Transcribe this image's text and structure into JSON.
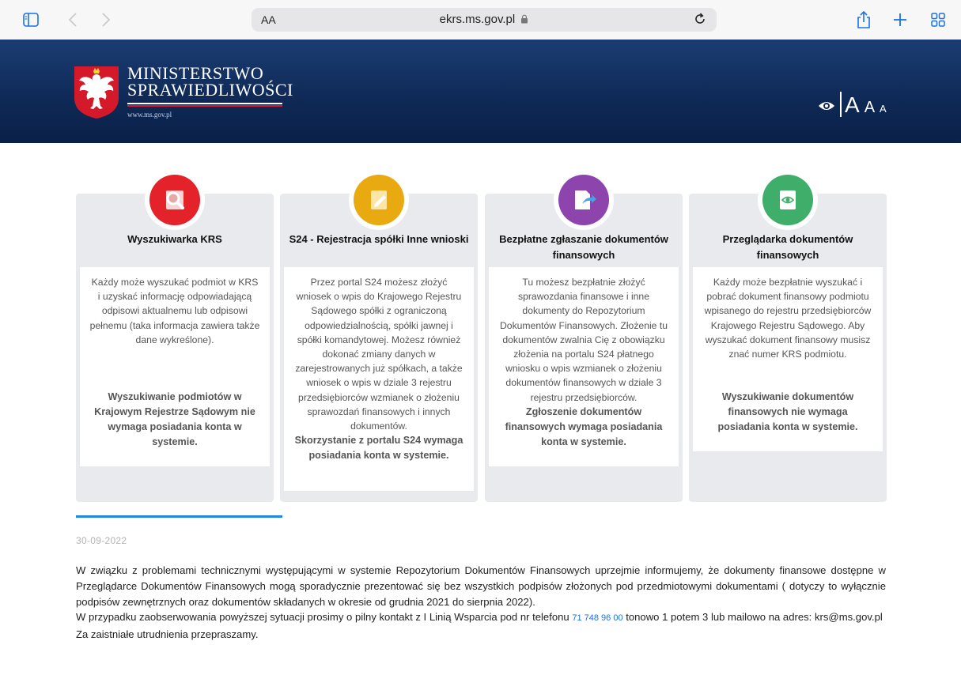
{
  "browser": {
    "url": "ekrs.ms.gov.pl",
    "reader_label": "AA",
    "colors": {
      "accent": "#1a73e8"
    }
  },
  "header": {
    "title_line1": "MINISTERSTWO",
    "title_line2": "SPRAWIEDLIWOŚCI",
    "website": "www.ms.gov.pl",
    "font_large": "A",
    "font_medium": "A",
    "font_small": "A",
    "colors": {
      "background": "#0f2a57",
      "flag_red": "#d41a2a"
    }
  },
  "cards": [
    {
      "title": "Wyszukiwarka KRS",
      "icon": "magnifier-icon",
      "color": "#e32229",
      "description": "Każdy może wyszukać podmiot w KRS i uzyskać informację odpowiadającą odpisowi aktualnemu lub odpisowi pełnemu (taka informacja zawiera także dane wykreślone).",
      "note": "Wyszukiwanie podmiotów w Krajowym Rejestrze Sądowym nie wymaga posiadania konta w systemie."
    },
    {
      "title": "S24 - Rejestracja spółki Inne wnioski",
      "icon": "pencil-document-icon",
      "color": "#e8a911",
      "description": "Przez portal S24 możesz złożyć wniosek o wpis do Krajowego Rejestru Sądowego spółki z ograniczoną odpowiedzialnością, spółki jawnej i spółki komandytowej. Możesz również dokonać zmiany danych w zarejestrowanych już spółkach, a także wniosek o wpis w dziale 3 rejestru przedsiębiorców wzmianek o złożeniu sprawozdań finansowych i innych dokumentów.",
      "note": "Skorzystanie z portalu S24 wymaga posiadania konta w systemie."
    },
    {
      "title": "Bezpłatne zgłaszanie dokumentów finansowych",
      "icon": "document-send-icon",
      "color": "#8e44ad",
      "description": "Tu możesz bezpłatnie złożyć sprawozdania finansowe i inne dokumenty do Repozytorium Dokumentów Finansowych. Złożenie tu dokumentów zwalnia Cię z obowiązku złożenia na portalu S24 płatnego wniosku o wpis wzmianek o złożeniu dokumentów finansowych w dziale 3 rejestru przedsiębiorców.",
      "note": "Zgłoszenie dokumentów finansowych wymaga posiadania konta w systemie."
    },
    {
      "title": "Przeglądarka dokumentów finansowych",
      "icon": "eye-document-icon",
      "color": "#3fae6a",
      "description": "Każdy może bezpłatnie wyszukać i pobrać dokument finansowy podmiotu wpisanego do rejestru przedsiębiorców Krajowego Rejestru Sądowego. Aby wyszukać dokument finansowy musisz znać numer KRS podmiotu.",
      "note": "Wyszukiwanie dokumentów finansowych nie wymaga posiadania konta w systemie."
    }
  ],
  "news": {
    "date": "30-09-2022",
    "paragraph1": "W związku z problemami technicznymi występującymi w systemie Repozytorium Dokumentów Finansowych uprzejmie informujemy, że dokumenty finansowe dostępne w Przeglądarce Dokumentów Finansowych mogą sporadycznie prezentować się bez wszystkich podpisów złożonych pod przedmiotowymi dokumentami ( dotyczy to wyłącznie podpisów zewnętrznych oraz dokumentów składanych w okresie od grudnia 2021 do sierpnia 2022).",
    "paragraph2_before": "W przypadku zaobserwowania powyższej sytuacji prosimy o pilny kontakt z I Linią Wsparcia pod nr telefonu",
    "phone": "71 748 96 00",
    "paragraph2_after": "tonowo 1 potem 3 lub mailowo na adres: krs@ms.gov.pl",
    "paragraph3": "Za zaistniałe utrudnienia przepraszamy.",
    "colors": {
      "link": "#1e6fd9",
      "divider": "#1e88e5"
    }
  }
}
